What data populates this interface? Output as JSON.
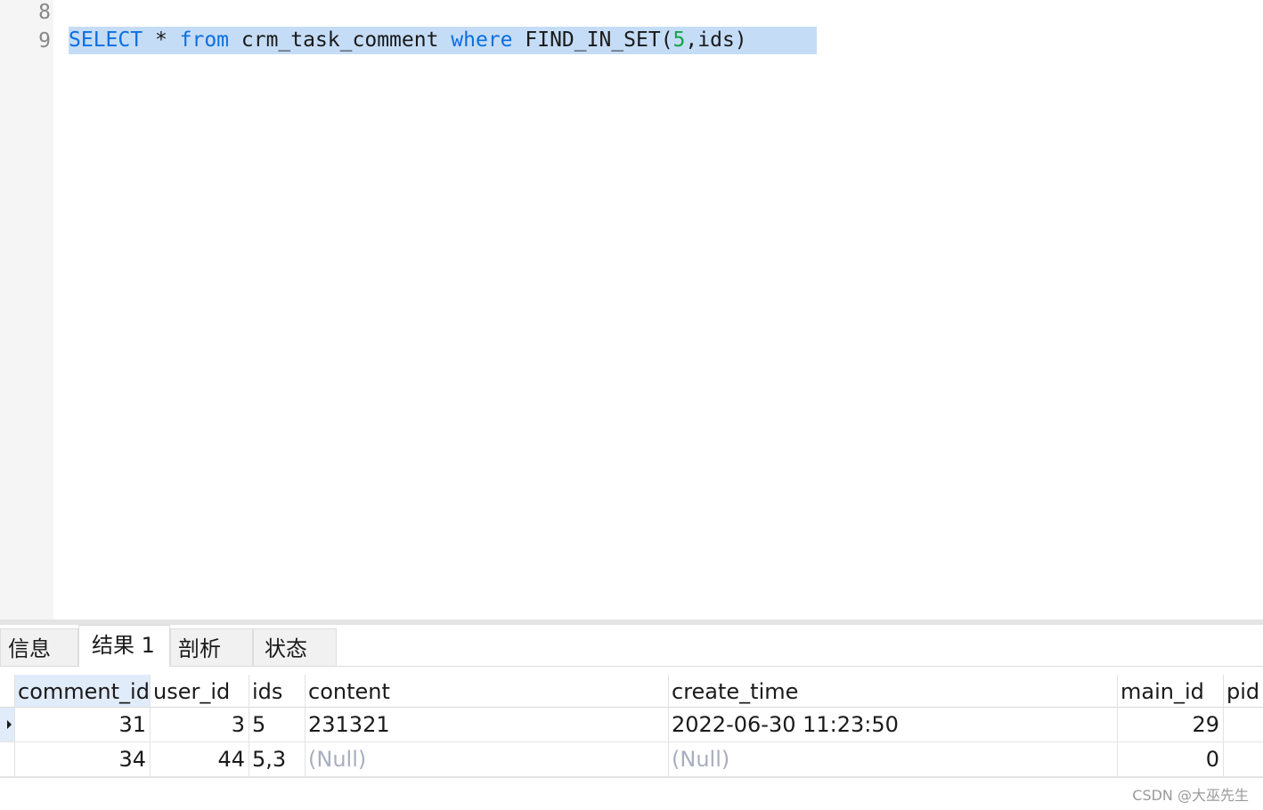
{
  "editor": {
    "line_numbers": [
      "8",
      "9"
    ],
    "query_tokens": [
      {
        "text": "SELECT",
        "kind": "keyword"
      },
      {
        "text": " * ",
        "kind": "plain"
      },
      {
        "text": "from",
        "kind": "keyword"
      },
      {
        "text": " crm_task_comment ",
        "kind": "plain"
      },
      {
        "text": "where",
        "kind": "keyword"
      },
      {
        "text": " FIND_IN_SET(",
        "kind": "plain"
      },
      {
        "text": "5",
        "kind": "number"
      },
      {
        "text": ",ids)",
        "kind": "plain"
      }
    ],
    "colors": {
      "keyword": "#0a6fe0",
      "number": "#16a34a",
      "plain": "#1a1a1a",
      "selection": "#c5dcf6"
    }
  },
  "tabs": [
    {
      "label": "信息",
      "active": false
    },
    {
      "label": "结果 1",
      "active": true
    },
    {
      "label": "剖析",
      "active": false
    },
    {
      "label": "状态",
      "active": false
    }
  ],
  "results": {
    "columns": [
      "comment_id",
      "user_id",
      "ids",
      "content",
      "create_time",
      "main_id",
      "pid"
    ],
    "selected_column": "comment_id",
    "rows": [
      {
        "comment_id": "31",
        "user_id": "3",
        "ids": "5",
        "content": "231321",
        "create_time": "2022-06-30 11:23:50",
        "main_id": "29",
        "pid": "",
        "current": true
      },
      {
        "comment_id": "34",
        "user_id": "44",
        "ids": "5,3",
        "content": "(Null)",
        "create_time": "(Null)",
        "main_id": "0",
        "pid": "",
        "current": false
      }
    ],
    "null_text": "(Null)"
  },
  "watermark": "CSDN @大巫先生"
}
